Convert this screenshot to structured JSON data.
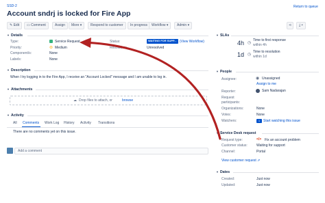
{
  "breadcrumb": "SSD-2",
  "return_link": "Return to queue",
  "title": "Account sndrj is locked for Fire App",
  "toolbar": {
    "edit": "Edit",
    "comment": "Comment",
    "assign": "Assign",
    "more": "More",
    "respond": "Respond to customer",
    "in_progress": "In progress",
    "workflow": "Workflow",
    "admin": "Admin"
  },
  "details": {
    "heading": "Details",
    "type_label": "Type:",
    "type_value": "Service Request",
    "priority_label": "Priority:",
    "priority_value": "Medium",
    "components_label": "Component/s:",
    "components_value": "None",
    "labels_label": "Labels:",
    "labels_value": "None",
    "status_label": "Status:",
    "status_value": "WAITING FOR SUPP...",
    "view_workflow": "(View Workflow)",
    "resolution_label": "Resolution:",
    "resolution_value": "Unresolved"
  },
  "description": {
    "heading": "Description",
    "text": "When I try logging in to the Fire App, I receive an \"Account Locked\" message and I am unable to log in."
  },
  "attachments": {
    "heading": "Attachments",
    "drop_text": "Drop files to attach, or",
    "browse": "browse"
  },
  "activity": {
    "heading": "Activity",
    "tabs": [
      "All",
      "Comments",
      "Work Log",
      "History",
      "Activity",
      "Transitions"
    ],
    "empty": "There are no comments yet on this issue.",
    "add_comment_placeholder": "Add a comment"
  },
  "slas": {
    "heading": "SLAs",
    "items": [
      {
        "time": "4h",
        "name": "Time to first response",
        "limit": "within 4h"
      },
      {
        "time": "1d",
        "name": "Time to resolution",
        "limit": "within 1d"
      }
    ]
  },
  "people": {
    "heading": "People",
    "assignee_label": "Assignee:",
    "assignee_value": "Unassigned",
    "assign_to_me": "Assign to me",
    "reporter_label": "Reporter:",
    "reporter_value": "Sam Nadarajan",
    "participants_label": "Request participants:",
    "organizations_label": "Organizations:",
    "organizations_value": "None",
    "votes_label": "Votes:",
    "votes_value": "None",
    "watchers_label": "Watchers:",
    "watchers_value": "Start watching this issue",
    "watchers_count": "1"
  },
  "service_desk": {
    "heading": "Service Desk request",
    "request_type_label": "Request type:",
    "request_type_value": "Fix an account problem",
    "customer_status_label": "Customer status:",
    "customer_status_value": "Waiting for support",
    "channel_label": "Channel:",
    "channel_value": "Portal",
    "view_request": "View customer request"
  },
  "dates": {
    "heading": "Dates",
    "created_label": "Created:",
    "created_value": "Just now",
    "updated_label": "Updated:",
    "updated_value": "Just now"
  },
  "colors": {
    "accent": "#0052cc",
    "status_badge": "#0052cc",
    "annotation_arrow": "#b22222",
    "service_request_icon": "#36b37e",
    "priority_icon": "#ffab00"
  }
}
